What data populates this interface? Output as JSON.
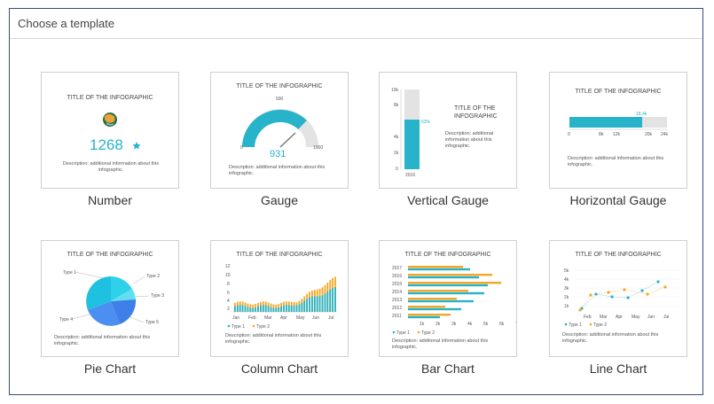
{
  "dialog": {
    "title": "Choose a template"
  },
  "templates": [
    {
      "label": "Number",
      "title": "TITLE OF THE INFOGRAPHIC",
      "value": "1268",
      "description": "Description: additional information about this infographic."
    },
    {
      "label": "Gauge",
      "title": "TITLE OF THE INFOGRAPHIC",
      "min": "0",
      "mid": "500",
      "max": "1000",
      "value": "931",
      "description": "Description: additional information about this infographic."
    },
    {
      "label": "Vertical Gauge",
      "title": "TITLE OF THE INFOGRAPHIC",
      "ticks": [
        "10k",
        "8k",
        "4k",
        "2k",
        "0"
      ],
      "pct": "63%",
      "year": "2016",
      "description": "Description: additional information about this infographic."
    },
    {
      "label": "Horizontal Gauge",
      "title": "TITLE OF THE INFOGRAPHIC",
      "ticks": [
        "0",
        "8k",
        "12k",
        "20k",
        "24k"
      ],
      "value": "18.4k",
      "description": "Description: additional information about this infographic."
    },
    {
      "label": "Pie Chart",
      "title": "TITLE OF THE INFOGRAPHIC",
      "legend": [
        "Type 1",
        "Type 2",
        "Type 3",
        "Type 4",
        "Type 5"
      ],
      "description": "Description: additional information about this infographic."
    },
    {
      "label": "Column Chart",
      "title": "TITLE OF THE INFOGRAPHIC",
      "yticks": [
        "12",
        "10",
        "8",
        "6",
        "4",
        "2"
      ],
      "months": [
        "Jan",
        "Feb",
        "Mar",
        "Apr",
        "May",
        "Jun",
        "Jul"
      ],
      "series": [
        "Type 1",
        "Type 2"
      ],
      "description": "Description: additional information about this infographic."
    },
    {
      "label": "Bar Chart",
      "title": "TITLE OF THE INFOGRAPHIC",
      "years": [
        "2017",
        "2016",
        "2015",
        "2014",
        "2013",
        "2012",
        "2011"
      ],
      "xticks": [
        "1k",
        "2k",
        "3k",
        "4k",
        "5k",
        "6k",
        "7k"
      ],
      "series": [
        "Type 1",
        "Type 2"
      ],
      "description": "Description: additional information about this infographic."
    },
    {
      "label": "Line Chart",
      "title": "TITLE OF THE INFOGRAPHIC",
      "yticks": [
        "5k",
        "4k",
        "3k",
        "2k",
        "1k"
      ],
      "months": [
        "Feb",
        "Mar",
        "Apr",
        "May",
        "Jun",
        "Jul"
      ],
      "series": [
        "Type 1",
        "Type 2"
      ],
      "description": "Description: additional information about this infographic."
    }
  ],
  "colors": {
    "teal": "#27b3c9",
    "orange": "#f5a623",
    "gray": "#e3e3e3",
    "pieBlue": "#3f7fe8"
  },
  "icons": {
    "globe": "globe-icon",
    "star": "star-icon"
  }
}
